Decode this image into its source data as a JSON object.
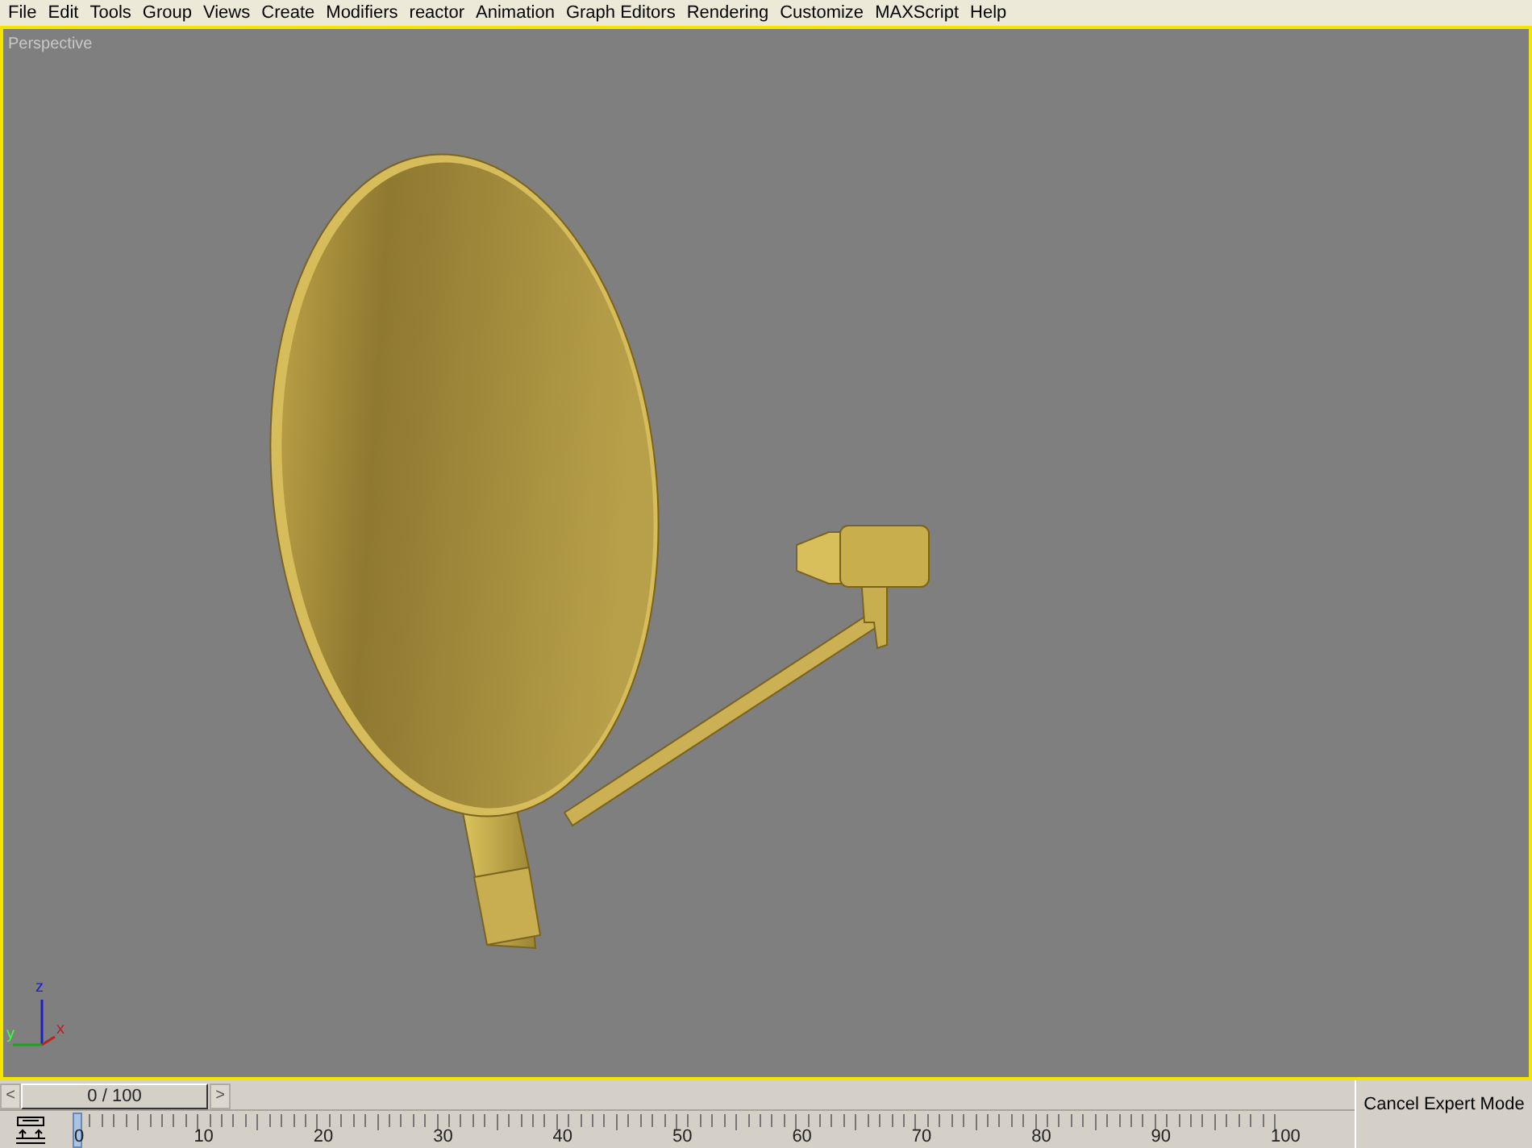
{
  "menu_bar": [
    "File",
    "Edit",
    "Tools",
    "Group",
    "Views",
    "Create",
    "Modifiers",
    "reactor",
    "Animation",
    "Graph Editors",
    "Rendering",
    "Customize",
    "MAXScript",
    "Help"
  ],
  "viewport": {
    "label": "Perspective",
    "active": true,
    "axis_labels": {
      "z": "z",
      "x": "x",
      "y": "y"
    }
  },
  "time_slider": {
    "prev": "<",
    "next": ">",
    "reading": "0 / 100",
    "level": 0
  },
  "track_bar": {
    "labels": [
      "0",
      "10",
      "20",
      "30",
      "40",
      "50",
      "60",
      "70",
      "80",
      "90",
      "100"
    ]
  },
  "cancel_button": "Cancel Expert Mode"
}
